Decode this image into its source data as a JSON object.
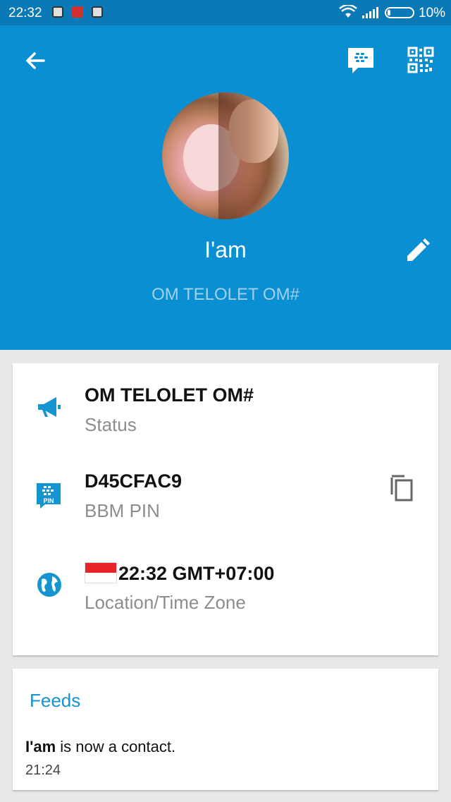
{
  "status_bar": {
    "time": "22:32",
    "battery": "10%",
    "battery_level": 0.1
  },
  "header": {
    "name": "I'am",
    "status": "OM TELOLET OM#",
    "color": "#0a8fd3"
  },
  "info": {
    "status": {
      "value": "OM TELOLET OM#",
      "label": "Status"
    },
    "pin": {
      "value": "D45CFAC9",
      "label": "BBM PIN",
      "icon_text": "PIN"
    },
    "location": {
      "value": "22:32 GMT+07:00",
      "label": "Location/Time Zone"
    }
  },
  "feeds": {
    "title": "Feeds",
    "item_name": "I'am",
    "item_text": " is now a contact.",
    "item_time": "21:24"
  },
  "accent_color": "#1595cf"
}
